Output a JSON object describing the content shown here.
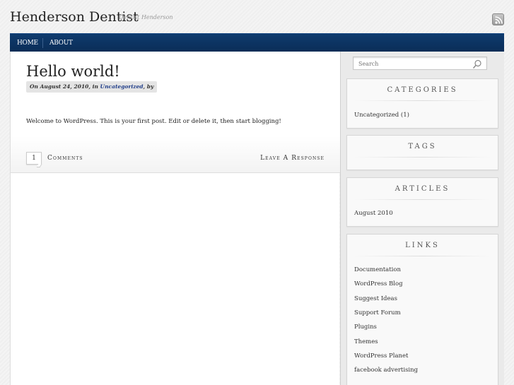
{
  "site": {
    "title": "Henderson Dentist",
    "description": "Dentist Henderson",
    "rss_icon": "rss-feed-icon"
  },
  "nav": {
    "items": [
      {
        "label": "HOME"
      },
      {
        "label": "ABOUT"
      }
    ]
  },
  "post": {
    "title": "Hello world!",
    "meta_prefix": "On August 24, 2010, in",
    "meta_category": "Uncategorized",
    "meta_suffix": ", by",
    "body": "Welcome to WordPress. This is your first post. Edit or delete it, then start blogging!",
    "comment_count": "1",
    "comments_label": "Comments",
    "respond_label": "Leave A Response"
  },
  "sidebar": {
    "search_placeholder": "Search",
    "categories": {
      "title": "CATEGORIES",
      "items": [
        "Uncategorized (1)"
      ]
    },
    "tags": {
      "title": "TAGS"
    },
    "articles": {
      "title": "ARTICLES",
      "items": [
        "August 2010"
      ]
    },
    "links": {
      "title": "LINKS",
      "items": [
        "Documentation",
        "WordPress Blog",
        "Suggest Ideas",
        "Support Forum",
        "Plugins",
        "Themes",
        "WordPress Planet",
        "facebook advertising"
      ]
    }
  },
  "colors": {
    "nav_bg": "#0b315f",
    "link": "#23408a"
  }
}
